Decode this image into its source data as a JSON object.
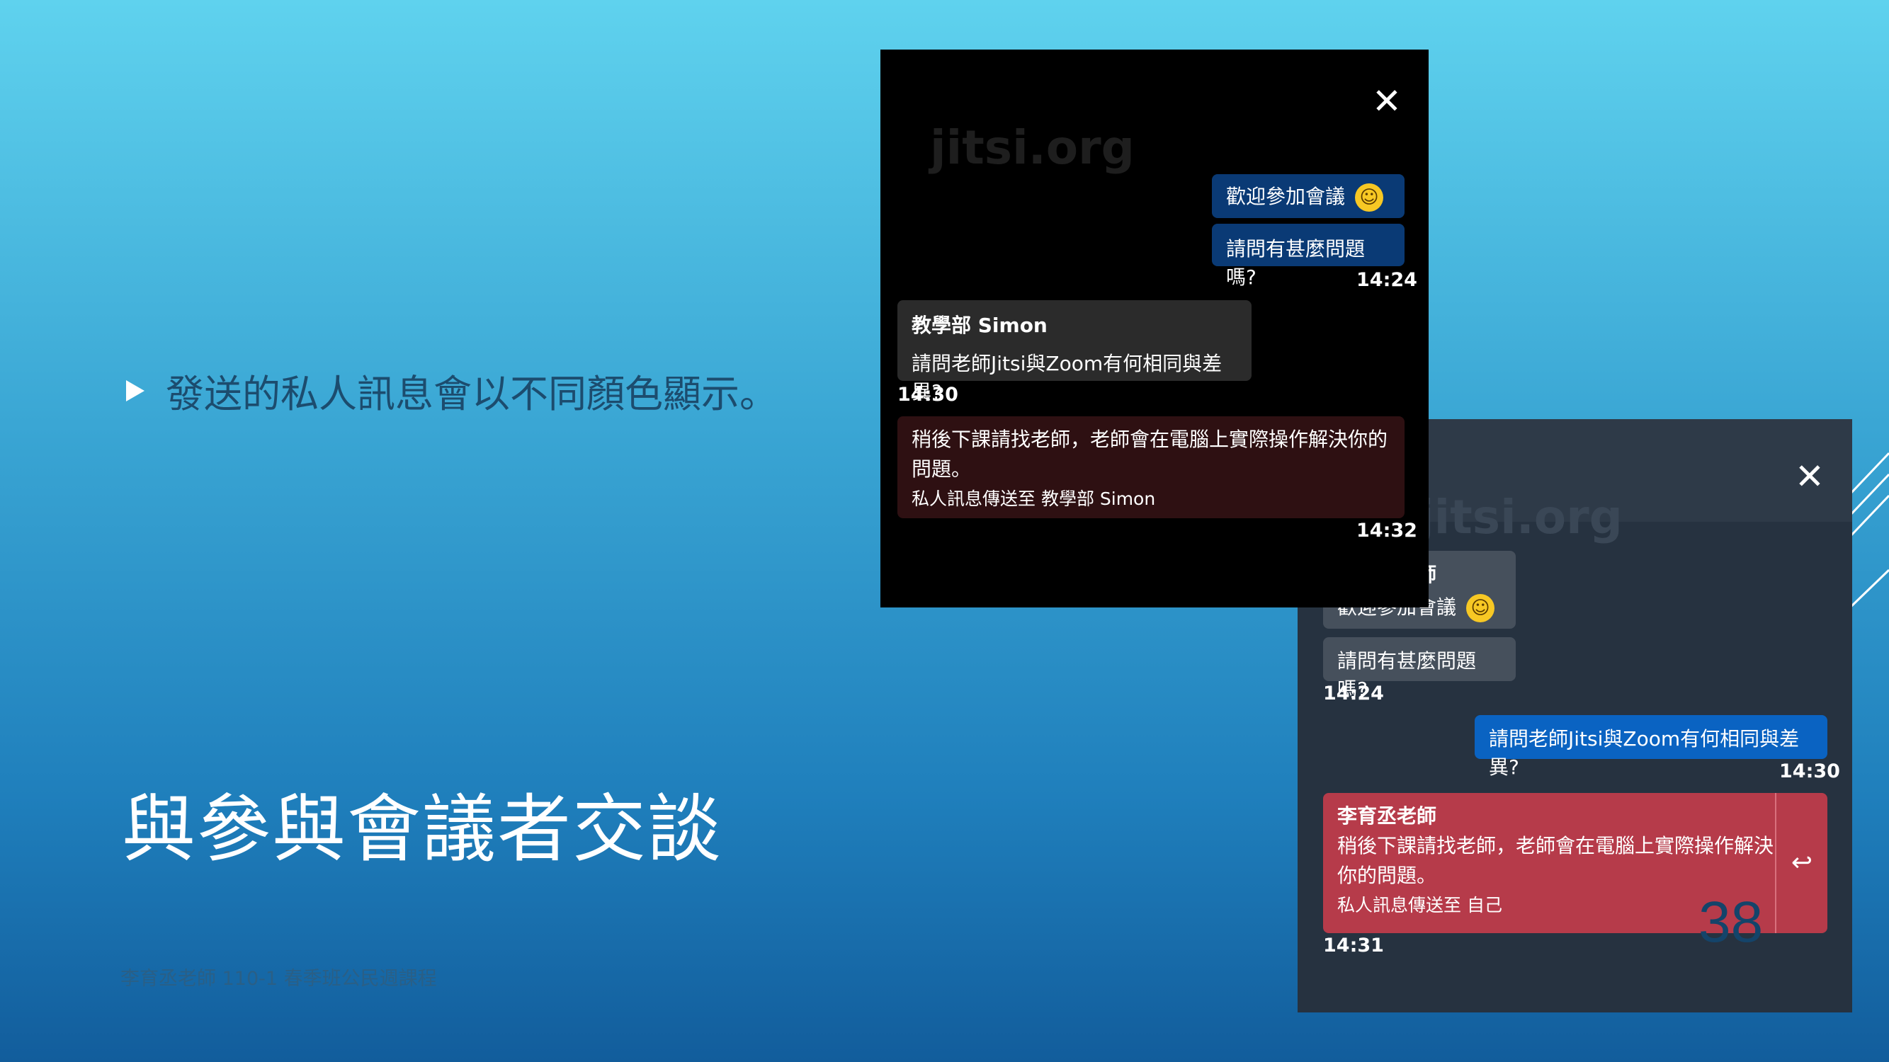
{
  "slide": {
    "bullet": "發送的私人訊息會以不同顏色顯示。",
    "title": "與參與會議者交談",
    "footer": "李育丞老師 110-1 春季班公民週課程",
    "page_number": "38"
  },
  "panel_dark": {
    "close_glyph": "✕",
    "watermark": "jitsi.org",
    "msg1": "歡迎參加會議",
    "emoji": "☺",
    "msg2": "請問有甚麼問題嗎?",
    "time1": "14:24",
    "in_sender": "教學部 Simon",
    "in_text": "請問老師Jitsi與Zoom有何相同與差異?",
    "time2": "14:30",
    "private_line1": "稍後下課請找老師，老師會在電腦上實際操作解決你的",
    "private_line2": "問題。",
    "private_note": "私人訊息傳送至 教學部 Simon",
    "time3": "14:32"
  },
  "panel_grey": {
    "close_glyph": "✕",
    "watermark": "jitsi.org",
    "partial_sender": "師",
    "msg1": "歡迎參加會議",
    "emoji": "☺",
    "msg2": "請問有甚麼問題嗎?",
    "time1": "14:24",
    "out_text": "請問老師Jitsi與Zoom有何相同與差異?",
    "time2": "14:30",
    "private_sender": "李育丞老師",
    "private_line1": "稍後下課請找老師，老師會在電腦上實際操作解決",
    "private_line2": "你的問題。",
    "private_note": "私人訊息傳送至 自己",
    "reply_glyph": "↩",
    "time3": "14:31"
  }
}
